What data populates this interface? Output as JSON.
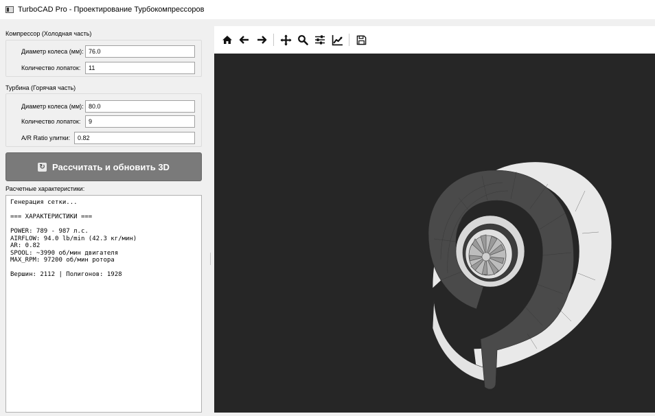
{
  "window": {
    "title": "TurboCAD Pro - Проектирование Турбокомпрессоров"
  },
  "compressor": {
    "group_title": "Компрессор (Холодная часть)",
    "wheel_diameter_label": "Диаметр колеса (мм):",
    "wheel_diameter_value": "76.0",
    "blade_count_label": "Количество лопаток:",
    "blade_count_value": "11"
  },
  "turbine": {
    "group_title": "Турбина (Горячая часть)",
    "wheel_diameter_label": "Диаметр колеса (мм):",
    "wheel_diameter_value": "80.0",
    "blade_count_label": "Количество лопаток:",
    "blade_count_value": "9",
    "ar_ratio_label": "A/R Ratio улитки:",
    "ar_ratio_value": "0.82"
  },
  "action": {
    "calculate_label": "Рассчитать и обновить 3D",
    "icon": "refresh-icon"
  },
  "results": {
    "title": "Расчетные характеристики:",
    "lines": "Генерация сетки...\n\n=== ХАРАКТЕРИСТИКИ ===\n\nPOWER: 789 - 987 л.с.\nAIRFLOW: 94.0 lb/min (42.3 кг/мин)\nAR: 0.82\nSPOOL: ~3990 об/мин двигателя\nMAX_RPM: 97200 об/мин ротора\n\nВершин: 2112 | Полигонов: 1928"
  },
  "toolbar": {
    "tools": [
      "home-icon",
      "back-arrow-icon",
      "forward-arrow-icon",
      "pan-icon",
      "zoom-icon",
      "configure-subplots-icon",
      "edit-axis-icon",
      "save-icon"
    ]
  },
  "viewer": {
    "background": "#262626",
    "shell_color": "#4a4a4a",
    "scroll_color": "#e6e6e6"
  }
}
